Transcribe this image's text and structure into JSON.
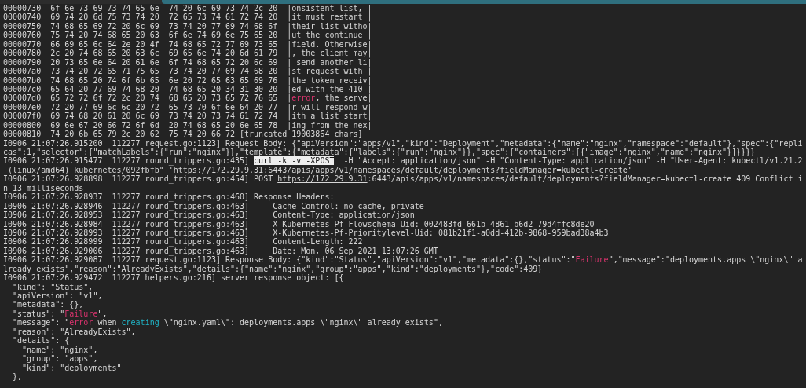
{
  "terminal": {
    "lines": [
      [
        {
          "kind": "plain",
          "text": "00000730  6f 6e 73 69 73 74 65 6e  74 20 6c 69 73 74 2c 20  |onsistent list, |"
        }
      ],
      [
        {
          "kind": "plain",
          "text": "00000740  69 74 20 6d 75 73 74 20  72 65 73 74 61 72 74 20  |it must restart |"
        }
      ],
      [
        {
          "kind": "plain",
          "text": "00000750  74 68 65 69 72 20 6c 69  73 74 20 77 69 74 68 6f  |their list witho|"
        }
      ],
      [
        {
          "kind": "plain",
          "text": "00000760  75 74 20 74 68 65 20 63  6f 6e 74 69 6e 75 65 20  |ut the continue |"
        }
      ],
      [
        {
          "kind": "plain",
          "text": "00000770  66 69 65 6c 64 2e 20 4f  74 68 65 72 77 69 73 65  |field. Otherwise|"
        }
      ],
      [
        {
          "kind": "plain",
          "text": "00000780  2c 20 74 68 65 20 63 6c  69 65 6e 74 20 6d 61 79  |, the client may|"
        }
      ],
      [
        {
          "kind": "plain",
          "text": "00000790  20 73 65 6e 64 20 61 6e  6f 74 68 65 72 20 6c 69  | send another li|"
        }
      ],
      [
        {
          "kind": "plain",
          "text": "000007a0  73 74 20 72 65 71 75 65  73 74 20 77 69 74 68 20  |st request with |"
        }
      ],
      [
        {
          "kind": "plain",
          "text": "000007b0  74 68 65 20 74 6f 6b 65  6e 20 72 65 63 65 69 76  |the token receiv|"
        }
      ],
      [
        {
          "kind": "plain",
          "text": "000007c0  65 64 20 77 69 74 68 20  74 68 65 20 34 31 30 20  |ed with the 410 |"
        }
      ],
      [
        {
          "kind": "plain",
          "text": "000007d0  65 72 72 6f 72 2c 20 74  68 65 20 73 65 72 76 65  |"
        },
        {
          "kind": "error",
          "text": "error"
        },
        {
          "kind": "plain",
          "text": ", the serve|"
        }
      ],
      [
        {
          "kind": "plain",
          "text": "000007e0  72 20 77 69 6c 6c 20 72  65 73 70 6f 6e 64 20 77  |r will respond w|"
        }
      ],
      [
        {
          "kind": "plain",
          "text": "000007f0  69 74 68 20 61 20 6c 69  73 74 20 73 74 61 72 74  |ith a list start|"
        }
      ],
      [
        {
          "kind": "plain",
          "text": "00000800  69 6e 67 20 66 72 6f 6d  20 74 68 65 20 6e 65 78  |ing from the nex|"
        }
      ],
      [
        {
          "kind": "plain",
          "text": "00000810  74 20 6b 65 79 2c 20 62  75 74 20 66 72 [truncated 19003864 chars]"
        }
      ],
      [
        {
          "kind": "plain",
          "text": "I0906 21:07:26.915200  112277 request.go:1123] Request Body: {\"apiVersion\":\"apps/v1\",\"kind\":\"Deployment\",\"metadata\":{\"name\":\"nginx\",\"namespace\":\"default\"},\"spec\":{\"repli"
        }
      ],
      [
        {
          "kind": "plain",
          "text": "cas\":1,\"selector\":{\"matchLabels\":{\"run\":\"nginx\"}},\"template\":{\"metadata\":{\"labels\":{\"run\":\"nginx\"}},\"spec\":{\"containers\":[{\"image\":\"nginx\",\"name\":\"nginx\"}]}}}}"
        }
      ],
      [
        {
          "kind": "plain",
          "text": "I0906 21:07:26.915477  112277 round_trippers.go:435] "
        },
        {
          "kind": "selection",
          "text": "curl -k -v -XPOST"
        },
        {
          "kind": "plain",
          "text": "  -H \"Accept: application/json\" -H \"Content-Type: application/json\" -H \"User-Agent: kubectl/v1.21.2"
        }
      ],
      [
        {
          "kind": "plain",
          "text": " (linux/amd64) kubernetes/092fbfb\" '"
        },
        {
          "kind": "link",
          "text": "https://172.29.9.31"
        },
        {
          "kind": "plain",
          "text": ":6443/apis/apps/v1/namespaces/default/deployments?fieldManager=kubectl-create'"
        }
      ],
      [
        {
          "kind": "plain",
          "text": "I0906 21:07:26.928898  112277 round_trippers.go:454] POST "
        },
        {
          "kind": "link",
          "text": "https://172.29.9.31"
        },
        {
          "kind": "plain",
          "text": ":6443/apis/apps/v1/namespaces/default/deployments?fieldManager=kubectl-create 409 Conflict i"
        }
      ],
      [
        {
          "kind": "plain",
          "text": "n 13 milliseconds"
        }
      ],
      [
        {
          "kind": "plain",
          "text": "I0906 21:07:26.928937  112277 round_trippers.go:460] Response Headers:"
        }
      ],
      [
        {
          "kind": "plain",
          "text": "I0906 21:07:26.928946  112277 round_trippers.go:463]     Cache-Control: no-cache, private"
        }
      ],
      [
        {
          "kind": "plain",
          "text": "I0906 21:07:26.928953  112277 round_trippers.go:463]     Content-Type: application/json"
        }
      ],
      [
        {
          "kind": "plain",
          "text": "I0906 21:07:26.928984  112277 round_trippers.go:463]     X-Kubernetes-Pf-Flowschema-Uid: 002483fd-661b-4861-b6d2-79d4ffc8de20"
        }
      ],
      [
        {
          "kind": "plain",
          "text": "I0906 21:07:26.928993  112277 round_trippers.go:463]     X-Kubernetes-Pf-Prioritylevel-Uid: 081b21f1-a0dd-412b-9868-959bad38a4b3"
        }
      ],
      [
        {
          "kind": "plain",
          "text": "I0906 21:07:26.928999  112277 round_trippers.go:463]     Content-Length: 222"
        }
      ],
      [
        {
          "kind": "plain",
          "text": "I0906 21:07:26.929006  112277 round_trippers.go:463]     Date: Mon, 06 Sep 2021 13:07:26 GMT"
        }
      ],
      [
        {
          "kind": "plain",
          "text": "I0906 21:07:26.929087  112277 request.go:1123] Response Body: {\"kind\":\"Status\",\"apiVersion\":\"v1\",\"metadata\":{},\"status\":\""
        },
        {
          "kind": "error",
          "text": "Failure"
        },
        {
          "kind": "plain",
          "text": "\",\"message\":\"deployments.apps \\\"nginx\\\" a"
        }
      ],
      [
        {
          "kind": "plain",
          "text": "lready exists\",\"reason\":\"AlreadyExists\",\"details\":{\"name\":\"nginx\",\"group\":\"apps\",\"kind\":\"deployments\"},\"code\":409}"
        }
      ],
      [
        {
          "kind": "plain",
          "text": "I0906 21:07:26.929472  112277 helpers.go:216] server response object: [{"
        }
      ],
      [
        {
          "kind": "plain",
          "text": "  \"kind\": \"Status\","
        }
      ],
      [
        {
          "kind": "plain",
          "text": "  \"apiVersion\": \"v1\","
        }
      ],
      [
        {
          "kind": "plain",
          "text": "  \"metadata\": {},"
        }
      ],
      [
        {
          "kind": "plain",
          "text": "  \"status\": \""
        },
        {
          "kind": "error",
          "text": "Failure"
        },
        {
          "kind": "plain",
          "text": "\","
        }
      ],
      [
        {
          "kind": "plain",
          "text": "  \"message\": \""
        },
        {
          "kind": "error",
          "text": "error"
        },
        {
          "kind": "plain",
          "text": " when "
        },
        {
          "kind": "keyword",
          "text": "creating"
        },
        {
          "kind": "plain",
          "text": " \\\"nginx.yaml\\\": deployments.apps \\\"nginx\\\" already exists\","
        }
      ],
      [
        {
          "kind": "plain",
          "text": "  \"reason\": \"AlreadyExists\","
        }
      ],
      [
        {
          "kind": "plain",
          "text": "  \"details\": {"
        }
      ],
      [
        {
          "kind": "plain",
          "text": "    \"name\": \"nginx\","
        }
      ],
      [
        {
          "kind": "plain",
          "text": "    \"group\": \"apps\","
        }
      ],
      [
        {
          "kind": "plain",
          "text": "    \"kind\": \"deployments\""
        }
      ],
      [
        {
          "kind": "plain",
          "text": "  },"
        }
      ]
    ]
  }
}
